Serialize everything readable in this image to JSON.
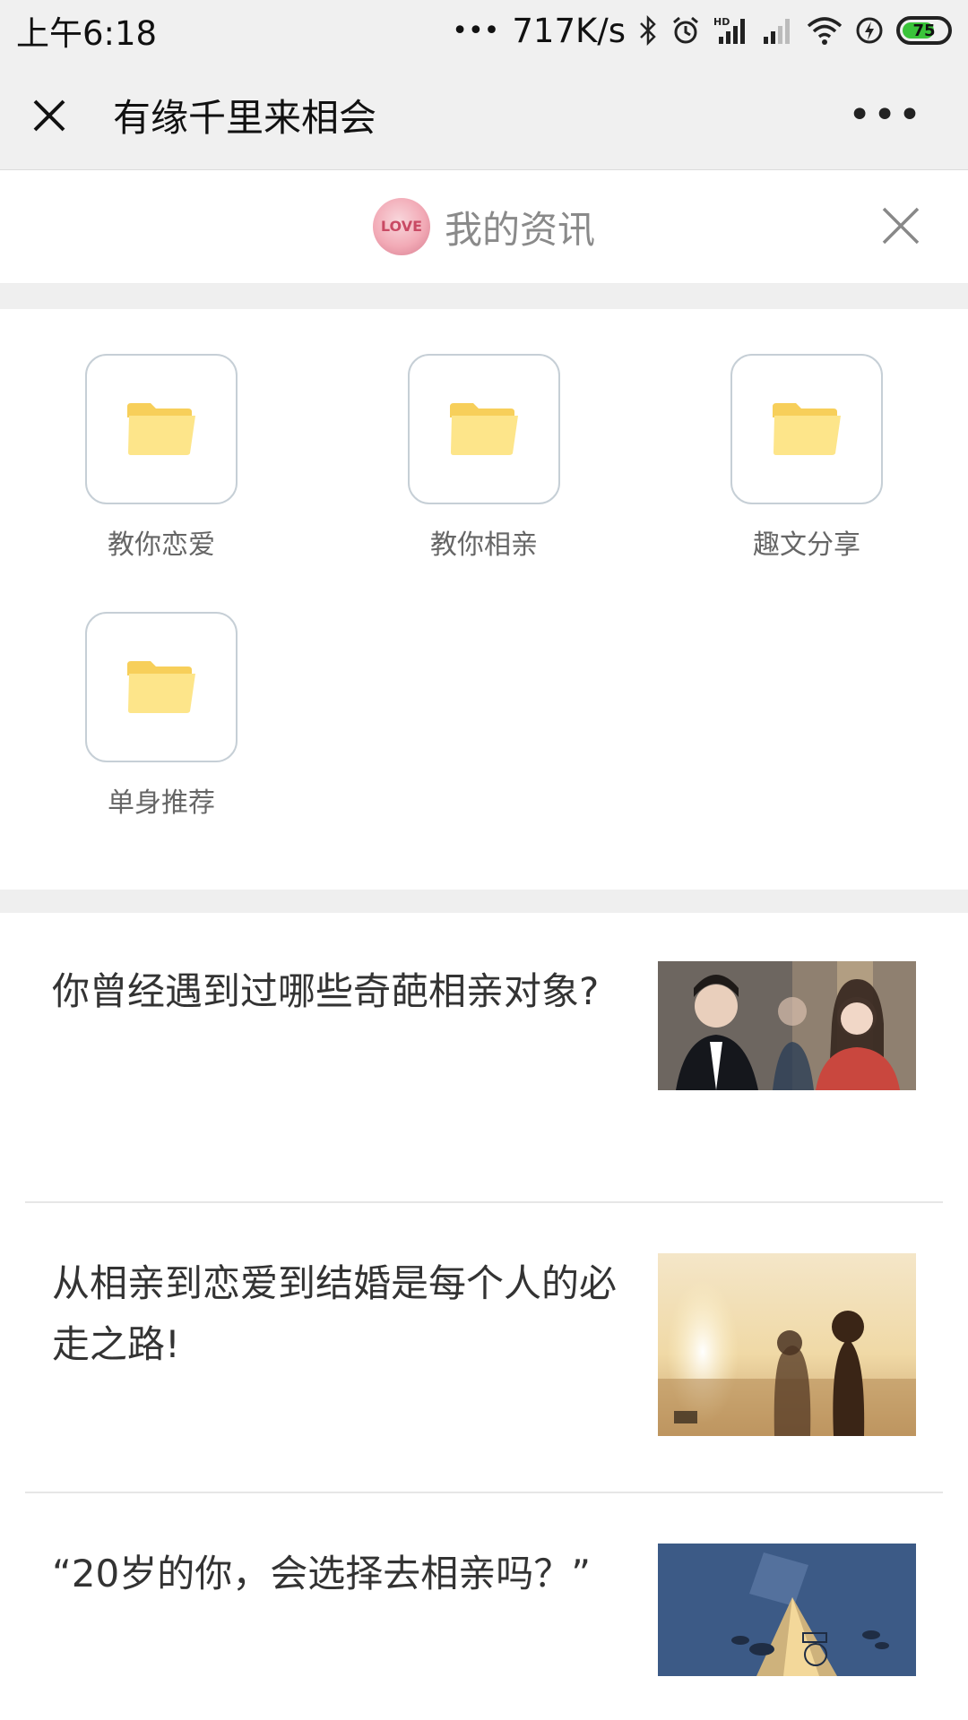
{
  "status": {
    "time": "上午6:18",
    "net_speed": "717K/s",
    "battery": "75",
    "battery_level": 0.75
  },
  "nav": {
    "title": "有缘千里来相会",
    "more": "•••"
  },
  "header": {
    "title": "我的资讯",
    "avatar_text": "LOVE"
  },
  "categories": [
    {
      "label": "教你恋爱"
    },
    {
      "label": "教你相亲"
    },
    {
      "label": "趣文分享"
    },
    {
      "label": "单身推荐"
    }
  ],
  "articles": [
    {
      "title": "你曾经遇到过哪些奇葩相亲对象?"
    },
    {
      "title": "从相亲到恋爱到结婚是每个人的必走之路!"
    },
    {
      "title": "“20岁的你，会选择去相亲吗？”"
    }
  ],
  "colors": {
    "folder": "#fde58a",
    "battery": "#3ac43a",
    "divider": "#efefef"
  }
}
